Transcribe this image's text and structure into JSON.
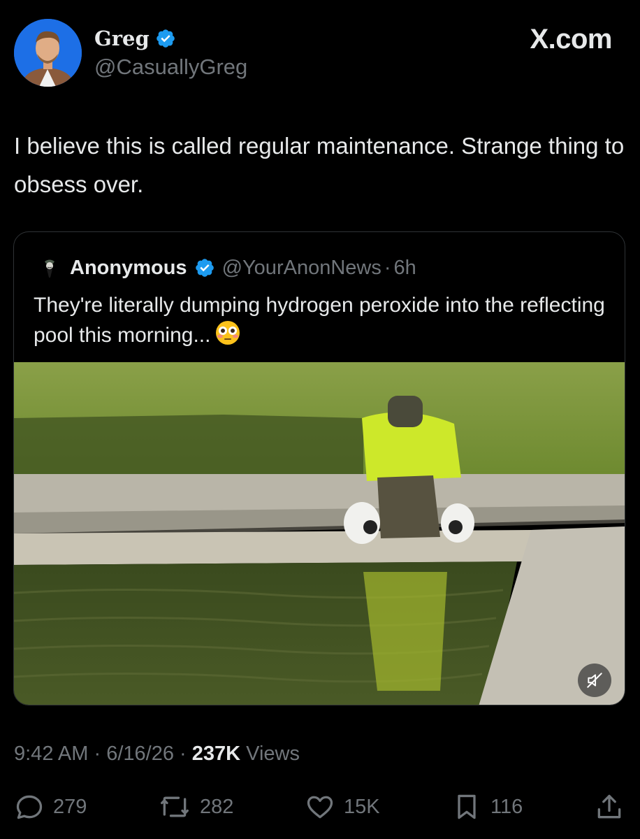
{
  "author": {
    "name": "Greg",
    "handle": "@CasuallyGreg",
    "verified": true
  },
  "site": "X.com",
  "tweet": {
    "text": "I believe this is called regular maintenance. Strange thing to obsess over."
  },
  "quoted": {
    "name": "Anonymous",
    "handle": "@YourAnonNews",
    "separator": "·",
    "time": "6h",
    "text": "They're literally dumping hydrogen peroxide into the reflecting pool this morning...",
    "emoji": "flushed-face"
  },
  "meta": {
    "time": "9:42 AM",
    "sep1": "·",
    "date": "6/16/26",
    "sep2": "·",
    "views_count": "237K",
    "views_label": "Views"
  },
  "actions": {
    "replies": "279",
    "reposts": "282",
    "likes": "15K",
    "bookmarks": "116"
  },
  "colors": {
    "background": "#000000",
    "text": "#e7e9ea",
    "secondary": "#71767b",
    "verified": "#1d9bf0",
    "border": "#2f3336"
  }
}
